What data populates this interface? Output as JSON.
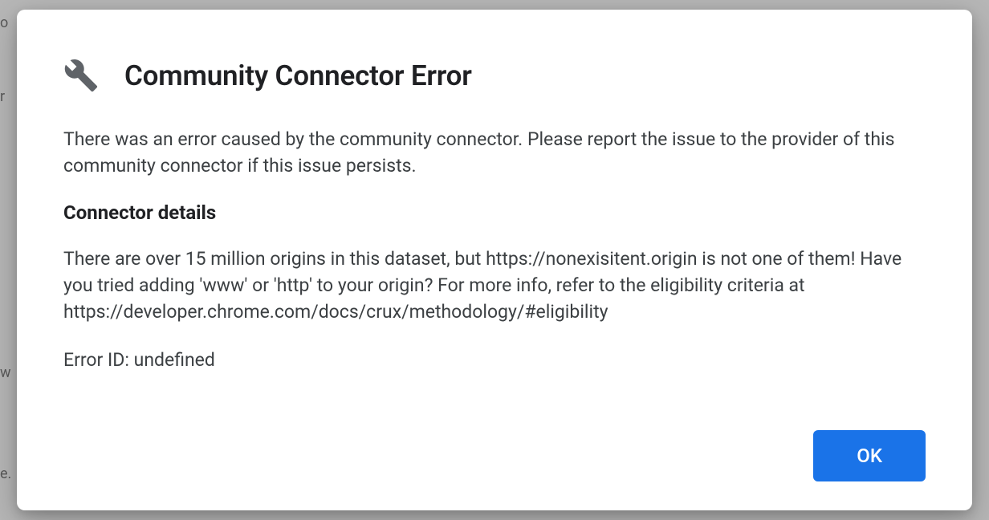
{
  "dialog": {
    "title": "Community Connector Error",
    "intro": "There was an error caused by the community connector. Please report the issue to the provider of this community connector if this issue persists.",
    "details_heading": "Connector details",
    "details_body": "There are over 15 million origins in this dataset, but https://nonexisitent.origin is not one of them! Have you tried adding 'www' or 'http' to your origin? For more info, refer to the eligibility criteria at https://developer.chrome.com/docs/crux/methodology/#eligibility",
    "error_id_line": "Error ID: undefined",
    "ok_label": "OK"
  }
}
